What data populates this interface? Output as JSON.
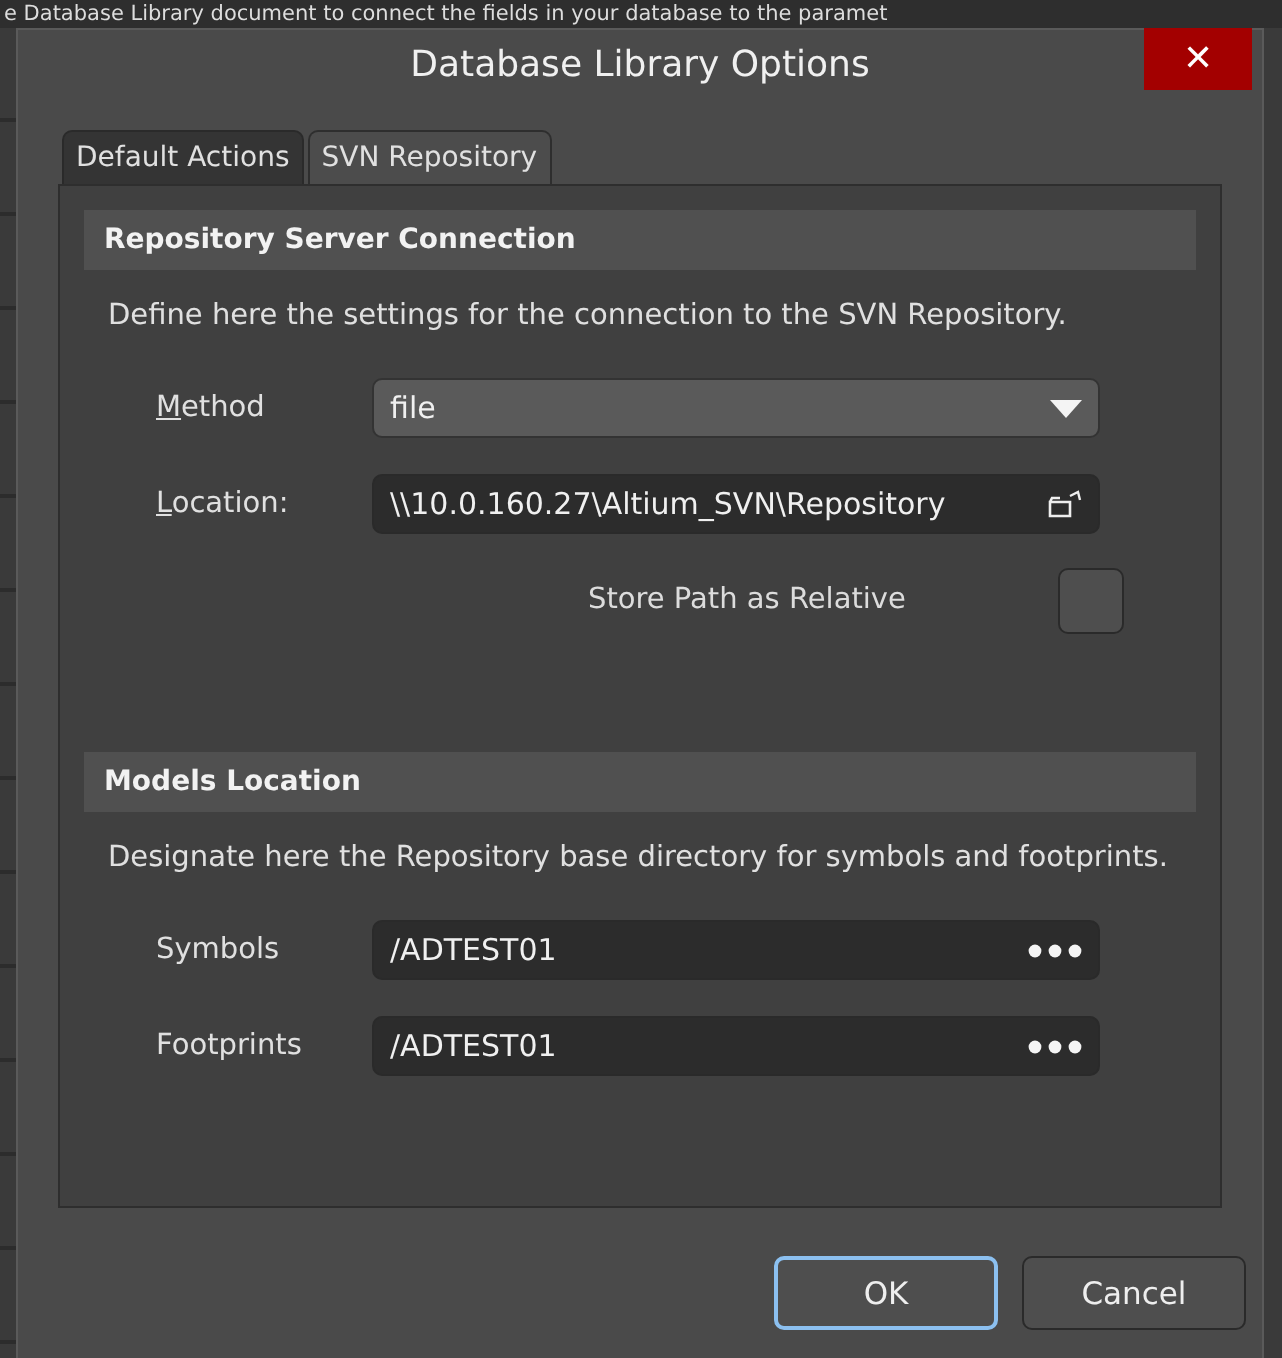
{
  "background": {
    "text": "e Database Library document to connect the fields in your database to the paramet"
  },
  "window": {
    "title": "Database Library Options",
    "close": "✕"
  },
  "tabs": [
    {
      "label": "Default Actions",
      "selected": false
    },
    {
      "label": "SVN Repository",
      "selected": true
    }
  ],
  "sections": [
    {
      "title": "Repository Server Connection",
      "description": "Define here the settings for the connection to the SVN Repository.",
      "fields": [
        {
          "kind": "dropdown",
          "label_key": "M",
          "label_post": "ethod",
          "value": "file"
        },
        {
          "kind": "path",
          "label_key": "L",
          "label_post": "ocation:",
          "value": "\\\\10.0.160.27\\Altium_SVN\\Repository"
        },
        {
          "kind": "checkbox",
          "label_pre": "Store Path as Relative",
          "checked": false
        }
      ]
    },
    {
      "title": "Models Location",
      "description": "Designate here the Repository base directory for symbols and footprints.",
      "fields": [
        {
          "kind": "browse",
          "label_pre": "Symbols",
          "value": "/ADTEST01"
        },
        {
          "kind": "browse",
          "label_pre": "Footprints",
          "value": "/ADTEST01"
        }
      ]
    }
  ],
  "buttons": [
    {
      "label": "OK",
      "selected": true
    },
    {
      "label": "Cancel",
      "selected": false
    }
  ]
}
